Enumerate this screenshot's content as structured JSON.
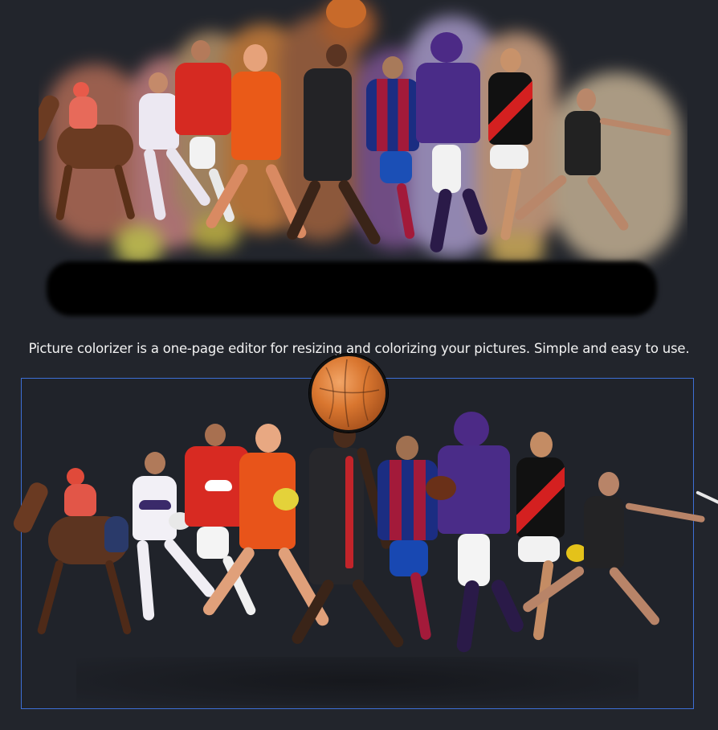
{
  "caption": {
    "text": "Picture colorizer is a one-page editor for resizing and colorizing your pictures. Simple and easy to use."
  },
  "editor": {
    "selection_color": "#3d6fd6"
  },
  "colors": {
    "background": "#22252c",
    "ball": "#d9762f"
  },
  "icons": {
    "ball_handle": "basketball-icon"
  }
}
